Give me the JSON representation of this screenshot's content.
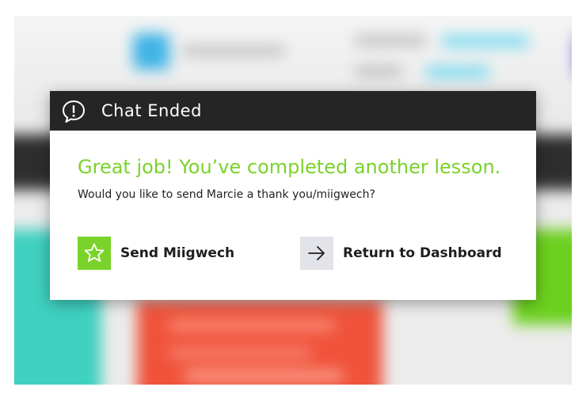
{
  "colors": {
    "accent_green": "#7ad32a",
    "header_bg": "#252525",
    "dashboard_icon_bg": "#e3e4e9"
  },
  "modal": {
    "title": "Chat Ended",
    "header_icon": "alert-speech-bubble-icon",
    "headline": "Great job! You’ve completed another lesson.",
    "subtext": "Would you like to send Marcie a thank you/miigwech?",
    "actions": {
      "send": {
        "label": "Send Miigwech",
        "icon": "star-icon"
      },
      "dashboard": {
        "label": "Return to Dashboard",
        "icon": "arrow-right-icon"
      }
    }
  }
}
